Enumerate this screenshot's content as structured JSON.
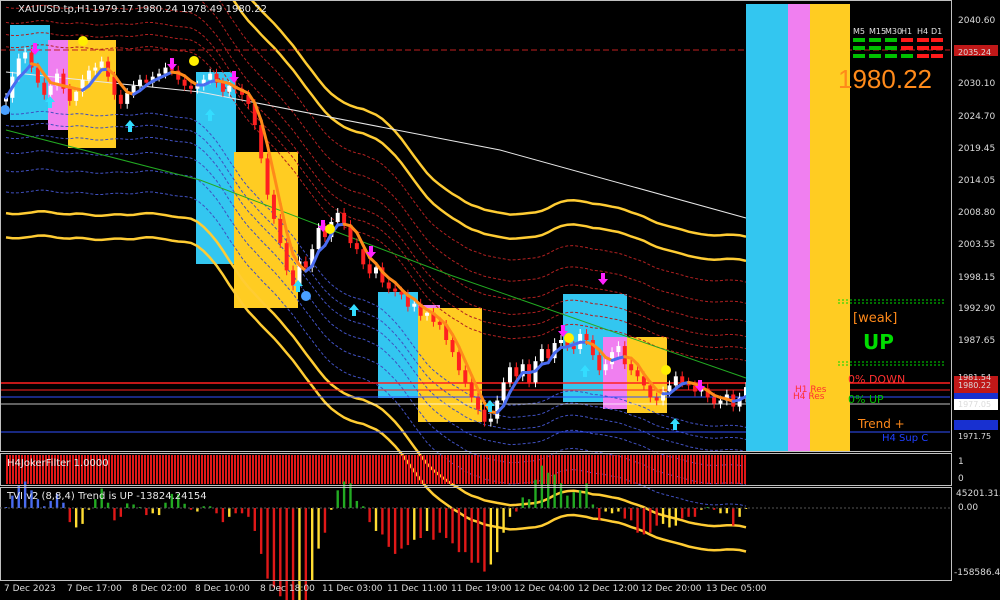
{
  "window": {
    "symbol_header": "XAUUSD.tp,H1",
    "ohlc_header": "1979.17 1980.24 1978.49 1980.22"
  },
  "price_axis": {
    "ticks": [
      "2040.60",
      "2035.24",
      "2030.10",
      "2024.70",
      "2019.45",
      "2014.05",
      "2008.80",
      "2003.55",
      "1998.15",
      "1992.90",
      "1987.65",
      "1981.54",
      "1980.22",
      "1977.05",
      "1971.75"
    ],
    "current_price": "1980.22"
  },
  "time_axis": {
    "ticks": [
      "7 Dec 2023",
      "7 Dec 17:00",
      "8 Dec 02:00",
      "8 Dec 10:00",
      "8 Dec 18:00",
      "11 Dec 03:00",
      "11 Dec 11:00",
      "11 Dec 19:00",
      "12 Dec 04:00",
      "12 Dec 12:00",
      "12 Dec 20:00",
      "13 Dec 05:00"
    ]
  },
  "panel": {
    "timeframes": [
      "M5",
      "M15",
      "M30",
      "H1",
      "H4",
      "D1"
    ],
    "big_price": "1980.22",
    "weak_label": "[weak]",
    "up_badge": "UP",
    "down_label": "0% DOWN",
    "up_label": "0%   UP",
    "trend_label": "Trend  +",
    "h4_sup_label": "H4 Sup C",
    "h1_res_label": "H1 Res",
    "h4_res_label": "H4 Res",
    "colors": {
      "up": "#00c000",
      "down": "#ff0000",
      "cyan": "#33c6f0",
      "pink": "#f07ff0",
      "yellow": "#ffcc22",
      "orange": "#ff8a1a"
    }
  },
  "indicator1": {
    "title": "H4JokerFilter 1.0000",
    "ticks": [
      "1",
      "0"
    ]
  },
  "indicator2": {
    "title": "TVI v2 (8,8,4) Trend is UP -13824.24154",
    "ticks": [
      "45201.315",
      "0.00",
      "-158586.4"
    ]
  },
  "chart_data": {
    "type": "candlestick",
    "symbol": "XAUUSD.tp",
    "timeframe": "H1",
    "ylim": [
      1969.5,
      2043.5
    ],
    "y_ticks": [
      2040.6,
      2035.24,
      2030.1,
      2024.7,
      2019.45,
      2014.05,
      2008.8,
      2003.55,
      1998.15,
      1992.9,
      1987.65,
      1981.54,
      1980.22,
      1977.05,
      1971.75
    ],
    "x_labels": [
      "7 Dec 2023",
      "7 Dec 17:00",
      "8 Dec 02:00",
      "8 Dec 10:00",
      "8 Dec 18:00",
      "11 Dec 03:00",
      "11 Dec 11:00",
      "11 Dec 19:00",
      "12 Dec 04:00",
      "12 Dec 12:00",
      "12 Dec 20:00",
      "13 Dec 05:00"
    ],
    "closes": [
      2028.0,
      2031.5,
      2034.5,
      2035.5,
      2033.0,
      2030.5,
      2028.5,
      2030.0,
      2032.0,
      2029.5,
      2027.5,
      2029.0,
      2031.0,
      2032.5,
      2033.0,
      2034.0,
      2031.5,
      2028.5,
      2027.0,
      2028.8,
      2030.0,
      2031.0,
      2030.5,
      2031.5,
      2032.0,
      2033.0,
      2032.5,
      2031.0,
      2030.0,
      2029.5,
      2030.0,
      2031.0,
      2032.0,
      2030.5,
      2029.0,
      2030.0,
      2029.5,
      2028.5,
      2027.0,
      2023.5,
      2018.0,
      2012.0,
      2008.0,
      2004.0,
      1999.5,
      1997.0,
      2001.0,
      2000.0,
      2003.0,
      2006.5,
      2005.0,
      2007.5,
      2009.0,
      2007.0,
      2004.0,
      2003.0,
      2000.5,
      1999.0,
      2000.0,
      1997.5,
      1996.5,
      1996.0,
      1995.5,
      1993.5,
      1994.0,
      1992.0,
      1992.5,
      1991.0,
      1990.5,
      1988.0,
      1986.0,
      1983.0,
      1981.0,
      1978.5,
      1976.5,
      1974.5,
      1975.0,
      1978.0,
      1981.0,
      1983.5,
      1982.0,
      1984.0,
      1981.0,
      1984.5,
      1986.5,
      1985.0,
      1987.5,
      1988.0,
      1987.0,
      1986.5,
      1989.0,
      1988.0,
      1985.5,
      1983.0,
      1984.0,
      1986.0,
      1987.0,
      1984.0,
      1983.0,
      1982.0,
      1980.5,
      1978.5,
      1978.0,
      1979.5,
      1980.5,
      1982.0,
      1981.0,
      1980.5,
      1979.5,
      1980.0,
      1978.5,
      1977.5,
      1978.0,
      1979.0,
      1977.0,
      1978.49,
      1980.22
    ],
    "h4_joker_filter": "1.0000",
    "tvi_trend": "UP",
    "tvi_value": -13824.24154,
    "tvi_ylim": [
      -158586.4,
      45201.315
    ]
  }
}
